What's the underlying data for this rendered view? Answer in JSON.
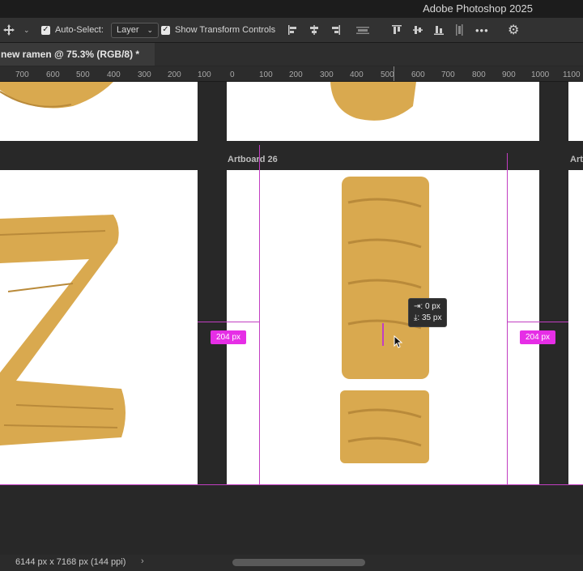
{
  "app": {
    "title": "Adobe Photoshop 2025"
  },
  "options_bar": {
    "move_tool_icon": "move-icon",
    "auto_select_label": "Auto-Select:",
    "auto_select_checked": true,
    "auto_select_target": "Layer",
    "show_transform_label": "Show Transform Controls",
    "show_transform_checked": true,
    "more_label": "•••"
  },
  "document_tab": {
    "title": "new ramen @ 75.3% (RGB/8) *"
  },
  "ruler": {
    "ticks": [
      "700",
      "600",
      "500",
      "400",
      "300",
      "200",
      "100",
      "0",
      "100",
      "200",
      "300",
      "400",
      "500",
      "600",
      "700",
      "800",
      "900",
      "1000",
      "1100"
    ]
  },
  "canvas": {
    "artboard_label": "Artboard 26",
    "artboard_label_partial": "Art",
    "distance_left": "204 px",
    "distance_right": "204 px",
    "tooltip_line1": "0 px",
    "tooltip_line2": "35 px",
    "guide_color": "#c23ec2",
    "badge_color": "#e62ee6",
    "noodle_color": "#d9a94f"
  },
  "status_bar": {
    "doc_size": "6144 px x 7168 px (144 ppi)",
    "arrow": "›"
  }
}
